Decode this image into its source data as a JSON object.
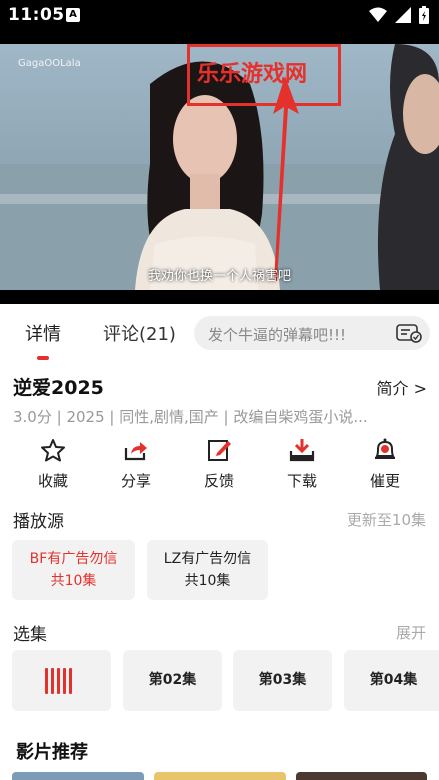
{
  "status_bar": {
    "time": "11:05",
    "badge": "A"
  },
  "video": {
    "logo_watermark": "GagaOOLala",
    "site_watermark": "乐乐游戏网",
    "subtitle": "我劝你也换一个人祸害吧"
  },
  "tabs": [
    {
      "label": "详情",
      "active": true
    },
    {
      "label": "评论(21)",
      "active": false
    }
  ],
  "danmu": {
    "placeholder": "发个牛逼的弹幕吧!!!"
  },
  "show": {
    "title": "逆爱2025",
    "intro_link": "简介 >",
    "meta": "3.0分   | 2025  |  同性,剧情,国产  |  改编自柴鸡蛋小说..."
  },
  "actions": [
    {
      "label": "收藏",
      "icon": "star-icon"
    },
    {
      "label": "分享",
      "icon": "share-icon"
    },
    {
      "label": "反馈",
      "icon": "feedback-icon"
    },
    {
      "label": "下载",
      "icon": "download-icon"
    },
    {
      "label": "催更",
      "icon": "bell-icon"
    }
  ],
  "sources": {
    "title": "播放源",
    "update_note": "更新至10集",
    "items": [
      {
        "line1": "BF有广告勿信",
        "line2": "共10集",
        "active": true
      },
      {
        "line1": "LZ有广告勿信",
        "line2": "共10集",
        "active": false
      }
    ]
  },
  "episodes": {
    "title": "选集",
    "expand": "展开",
    "items": [
      {
        "label": "",
        "playing": true
      },
      {
        "label": "第02集",
        "playing": false
      },
      {
        "label": "第03集",
        "playing": false
      },
      {
        "label": "第04集",
        "playing": false
      }
    ]
  },
  "recommend": {
    "title": "影片推荐"
  },
  "colors": {
    "accent": "#e5312c",
    "muted": "#999999",
    "chip_bg": "#f2f2f2"
  }
}
